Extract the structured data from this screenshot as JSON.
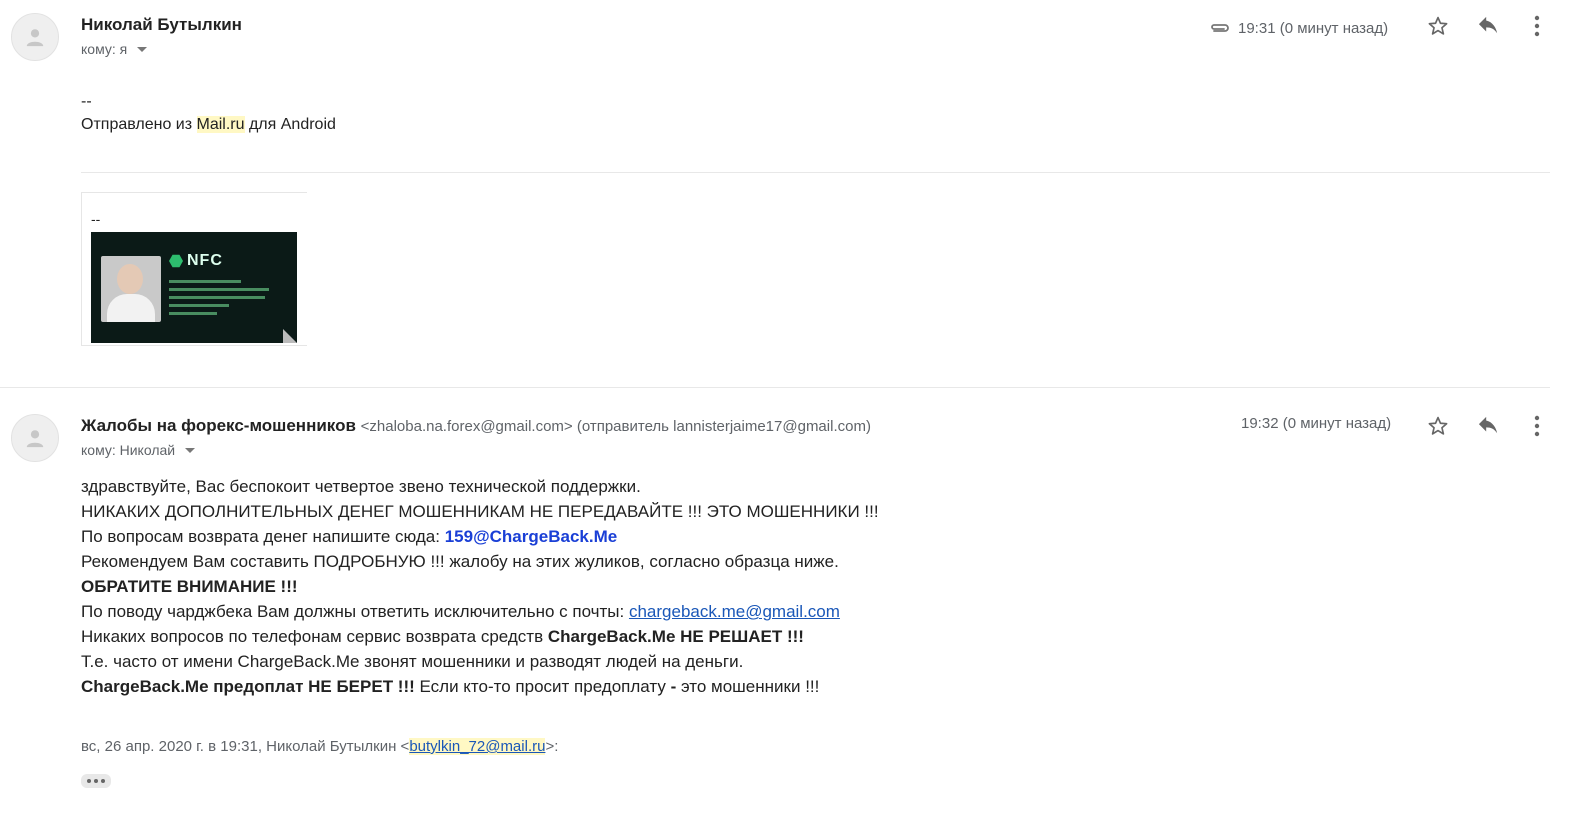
{
  "message1": {
    "sender_name": "Николай Бутылкин",
    "to_label": "кому: я",
    "time": "19:31 (0 минут назад)",
    "signature_dash": "--",
    "signature_prefix": "Отправлено из ",
    "signature_app": "Mail.ru",
    "signature_suffix": " для Android",
    "quote_dash": "--",
    "card_brand": "NFC",
    "icons": [
      "attachment-icon",
      "star-icon",
      "reply-icon",
      "more-vert-icon"
    ]
  },
  "message2": {
    "sender_name": "Жалобы на форекс-мошенников",
    "sender_email": "<zhaloba.na.forex@gmail.com> (отправитель lannisterjaime17@gmail.com)",
    "to_label": "кому: Николай",
    "time": "19:32 (0 минут назад)",
    "body": {
      "line1": "здравствуйте, Вас беспокоит четвертое звено технической поддержки.",
      "line2": "НИКАКИХ ДОПОЛНИТЕЛЬНЫХ ДЕНЕГ МОШЕННИКАМ НЕ ПЕРЕДАВАЙТЕ !!! ЭТО МОШЕННИКИ !!!",
      "line3_prefix": "По вопросам возврата денег напишите сюда: ",
      "line3_email": "159@ChargeBack.Me",
      "line4": "Рекомендуем Вам составить ПОДРОБНУЮ !!! жалобу на этих жуликов, согласно образца ниже.",
      "line5": "ОБРАТИТЕ ВНИМАНИЕ !!!",
      "line6_prefix": "По поводу чарджбека Вам должны ответить исключительно с почты: ",
      "line6_link": "chargeback.me@gmail.com",
      "line7_prefix": "Никаких вопросов по телефонам сервис возврата средств ",
      "line7_bold": "ChargeBack.Me НЕ РЕШАЕТ !!!",
      "line8": "Т.е. часто от имени ChargeBack.Me звонят мошенники и разводят людей на деньги.",
      "line9_bold": "ChargeBack.Me предоплат НЕ БЕРЕТ !!!",
      "line9_mid": " Если кто-то просит предоплату ",
      "line9_dash": "-",
      "line9_end": " это мошенники !!!"
    },
    "quote_header_prefix": "вс, 26 апр. 2020 г. в 19:31, Николай Бутылкин <",
    "quote_header_email": "butylkin_72@mail.ru",
    "quote_header_suffix": ">:",
    "icons": [
      "star-icon",
      "reply-icon",
      "more-vert-icon"
    ]
  }
}
